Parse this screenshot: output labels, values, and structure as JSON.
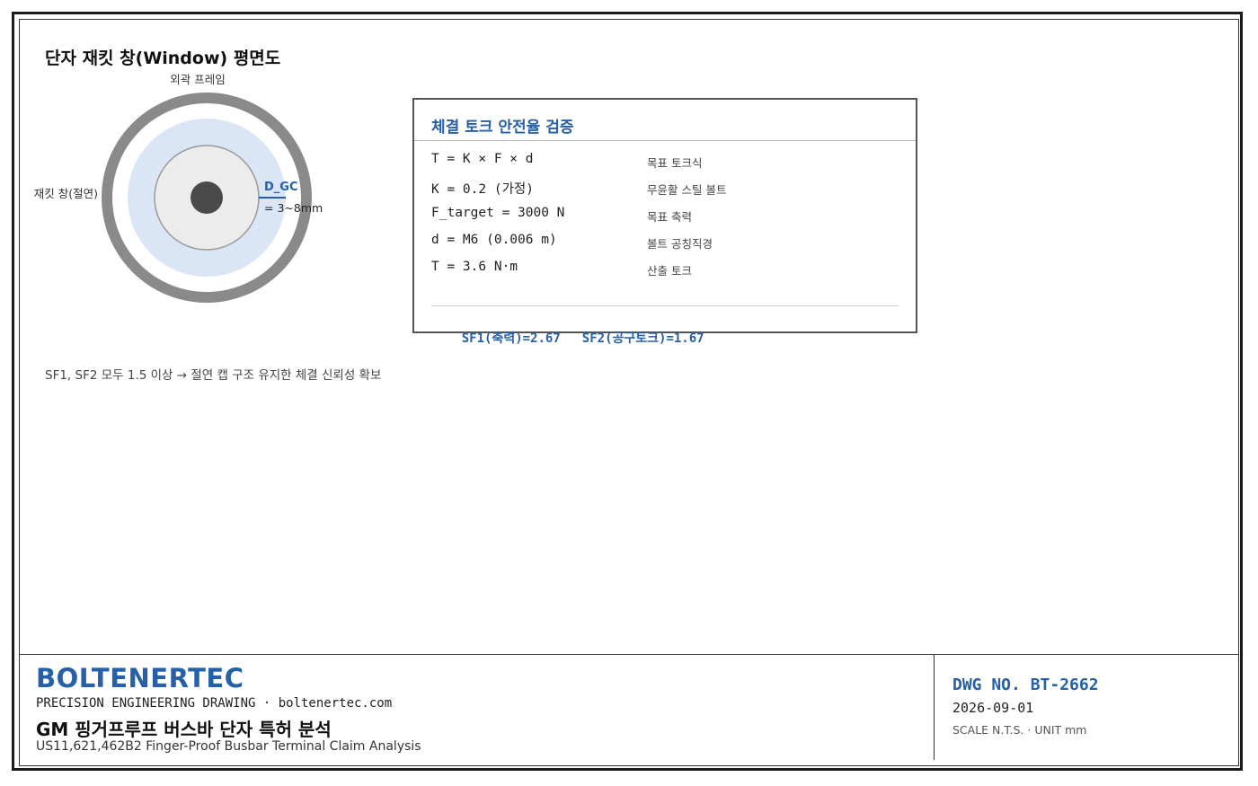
{
  "diagram": {
    "title": "단자 재킷 창(Window) 평면도",
    "labels": {
      "outer_frame": "외곽 프레임",
      "jacket_window": "재킷 창(절연)",
      "dimension_name": "D_GC",
      "dimension_value": "= 3~8mm"
    },
    "colors": {
      "outer_ring": "#8a8a8a",
      "insulation": "#dae6f5",
      "inner_cap": "#ececec",
      "bolt": "#4a4a4a",
      "accent": "#2560a8"
    }
  },
  "torque_check": {
    "title": "체결 토크 안전율 검증",
    "rows": [
      {
        "formula": "T = K × F × d",
        "note": "목표 토크식"
      },
      {
        "formula": "K = 0.2 (가정)",
        "note": "무윤활 스틸 볼트"
      },
      {
        "formula": "F_target = 3000 N",
        "note": "목표 축력"
      },
      {
        "formula": "d = M6 (0.006 m)",
        "note": "볼트 공칭직경"
      },
      {
        "formula": "T = 3.6 N·m",
        "note": "산출 토크"
      }
    ],
    "sf1": "SF1(축력)=2.67",
    "sf2": "SF2(공구토크)=1.67"
  },
  "conclusion": "SF1, SF2 모두 1.5 이상 → 절연 캡 구조 유지한 체결 신뢰성 확보",
  "title_block": {
    "brand": "BOLTENERTEC",
    "tagline": "PRECISION ENGINEERING DRAWING · boltenertec.com",
    "project_title": "GM 핑거프루프 버스바 단자 특허 분석",
    "project_subtitle": "US11,621,462B2 Finger-Proof Busbar Terminal Claim Analysis",
    "dwg_no": "DWG NO. BT-2662",
    "date": "2026-09-01",
    "scale": "SCALE N.T.S. · UNIT mm"
  }
}
